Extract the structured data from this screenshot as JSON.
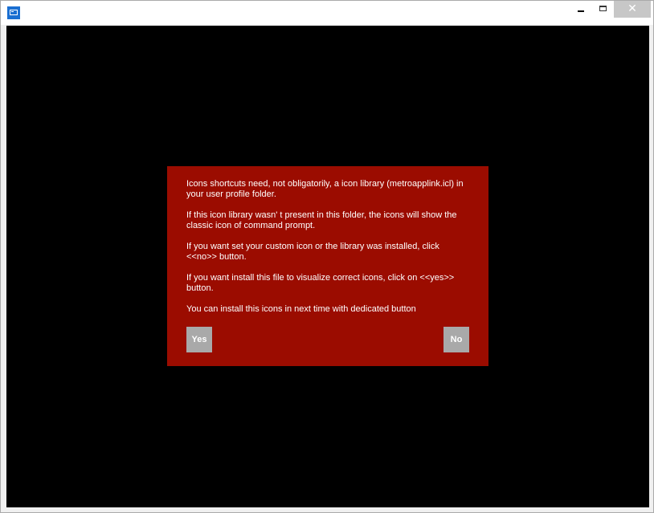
{
  "window": {
    "app_icon": "console-app-icon",
    "minimize_icon": "minimize-icon",
    "maximize_icon": "maximize-icon",
    "close_icon": "close-icon",
    "close_glyph": "✕"
  },
  "dialog": {
    "paragraphs": [
      "Icons shortcuts need, not obligatorily, a icon library (metroapplink.icl) in your user profile folder.",
      "If this icon library wasn' t present in this folder, the icons will show the classic icon of command prompt.",
      "If you want set your custom icon or the library was installed, click <<no>> button.",
      "If you want install this file to visualize correct icons, click on <<yes>> button.",
      "You can install this icons in next time with dedicated button"
    ],
    "yes_label": "Yes",
    "no_label": "No"
  },
  "colors": {
    "dialog_background": "#9b0c00",
    "client_background": "#000000",
    "button_background": "#a9a9a9",
    "title_icon": "#1a6fd1"
  }
}
